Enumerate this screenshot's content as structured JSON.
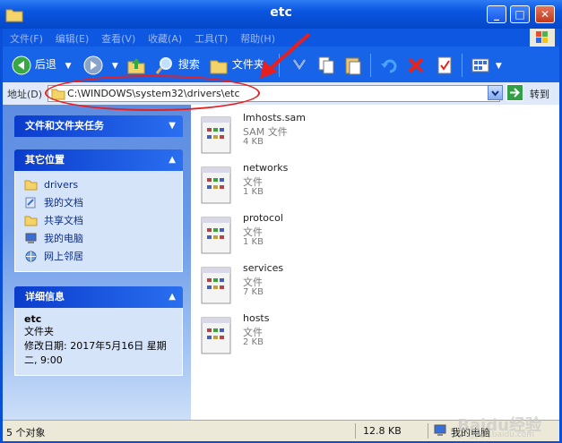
{
  "window": {
    "title": "etc"
  },
  "menu": [
    "文件(F)",
    "编辑(E)",
    "查看(V)",
    "收藏(A)",
    "工具(T)",
    "帮助(H)"
  ],
  "toolbar": {
    "back_label": "后退",
    "search_label": "搜索",
    "folders_label": "文件夹"
  },
  "address": {
    "label": "地址(D)",
    "path": "C:\\WINDOWS\\system32\\drivers\\etc",
    "go_label": "转到"
  },
  "tasks": {
    "file_tasks_title": "文件和文件夹任务",
    "other_places_title": "其它位置",
    "places": [
      "drivers",
      "我的文档",
      "共享文档",
      "我的电脑",
      "网上邻居"
    ],
    "details_title": "详细信息",
    "details": {
      "name": "etc",
      "type": "文件夹",
      "modified": "修改日期: 2017年5月16日 星期二, 9:00"
    }
  },
  "files": [
    {
      "name": "lmhosts.sam",
      "type": "SAM 文件",
      "size": "4 KB"
    },
    {
      "name": "networks",
      "type": "文件",
      "size": "1 KB"
    },
    {
      "name": "protocol",
      "type": "文件",
      "size": "1 KB"
    },
    {
      "name": "services",
      "type": "文件",
      "size": "7 KB"
    },
    {
      "name": "hosts",
      "type": "文件",
      "size": "2 KB"
    }
  ],
  "status": {
    "objects": "5 个对象",
    "size": "12.8 KB",
    "location": "我的电脑"
  },
  "watermark": {
    "text": "Baidu经验",
    "url": "jingyan.baidu.com"
  },
  "colors": {
    "titlebar": "#0a55e0",
    "taskpane": "#6b99e8",
    "highlight": "#e62020"
  }
}
